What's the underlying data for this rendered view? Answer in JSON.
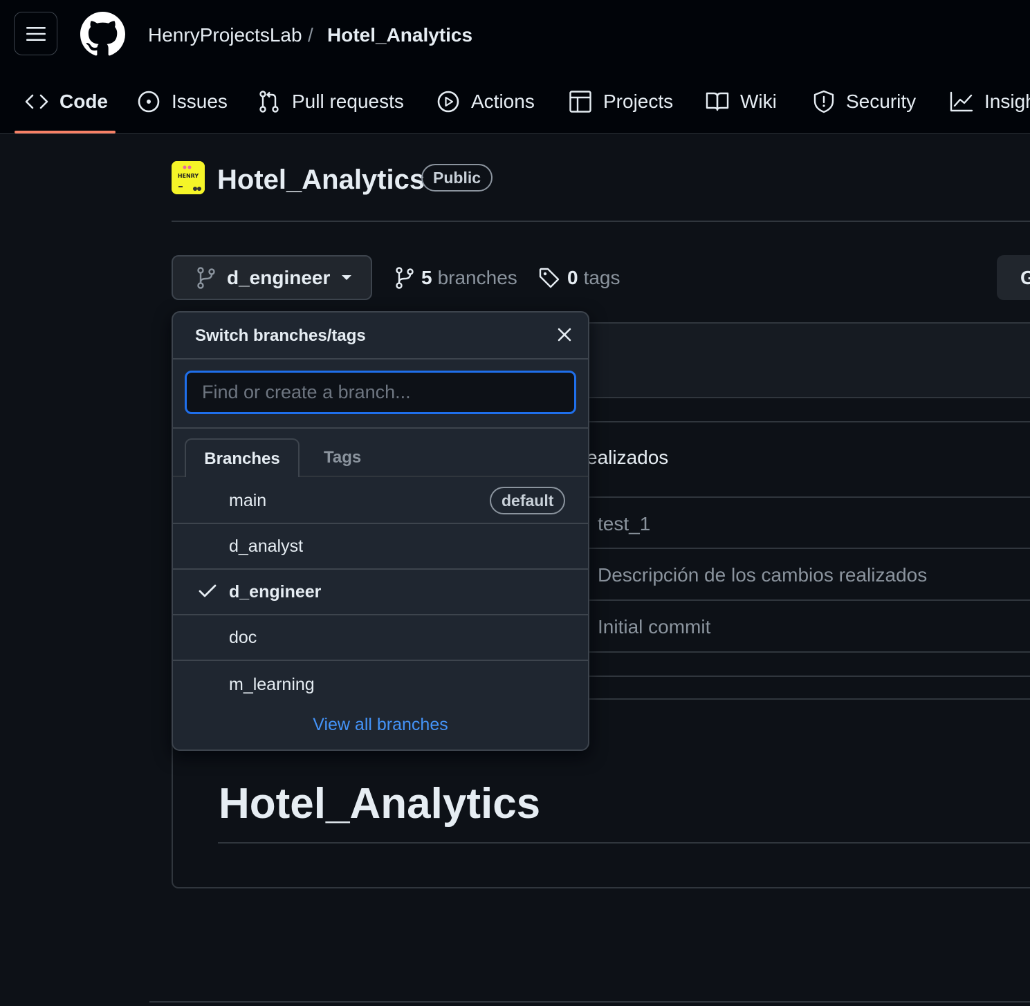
{
  "header": {
    "owner": "HenryProjectsLab",
    "separator": "/",
    "repo": "Hotel_Analytics"
  },
  "nav": [
    {
      "label": "Code",
      "icon": "code-icon",
      "active": true
    },
    {
      "label": "Issues",
      "icon": "issue-opened-icon"
    },
    {
      "label": "Pull requests",
      "icon": "git-pull-request-icon"
    },
    {
      "label": "Actions",
      "icon": "play-icon"
    },
    {
      "label": "Projects",
      "icon": "table-icon"
    },
    {
      "label": "Wiki",
      "icon": "book-icon"
    },
    {
      "label": "Security",
      "icon": "shield-icon"
    },
    {
      "label": "Insigh",
      "icon": "graph-icon"
    }
  ],
  "repo": {
    "title": "Hotel_Analytics",
    "visibility": "Public",
    "avatar_text": "HENRY"
  },
  "branch_bar": {
    "current_branch": "d_engineer",
    "branches_count": "5",
    "branches_label": "branches",
    "tags_count": "0",
    "tags_label": "tags",
    "right_button": "G"
  },
  "background_list": {
    "header_text": "ealizados",
    "rows": [
      "test_1",
      "Descripción de los cambios realizados",
      "Initial commit"
    ]
  },
  "readme": {
    "title": "Hotel_Analytics"
  },
  "dropdown": {
    "title": "Switch branches/tags",
    "search_placeholder": "Find or create a branch...",
    "tabs": [
      "Branches",
      "Tags"
    ],
    "branches": [
      {
        "name": "main",
        "badge": "default"
      },
      {
        "name": "d_analyst"
      },
      {
        "name": "d_engineer",
        "selected": true
      },
      {
        "name": "doc"
      },
      {
        "name": "m_learning"
      }
    ],
    "footer_link": "View all branches"
  },
  "colors": {
    "background": "#0d1117",
    "header_bg": "#010409",
    "accent_underline": "#f78166",
    "focus_border": "#1f6feb",
    "link": "#4493f8"
  }
}
